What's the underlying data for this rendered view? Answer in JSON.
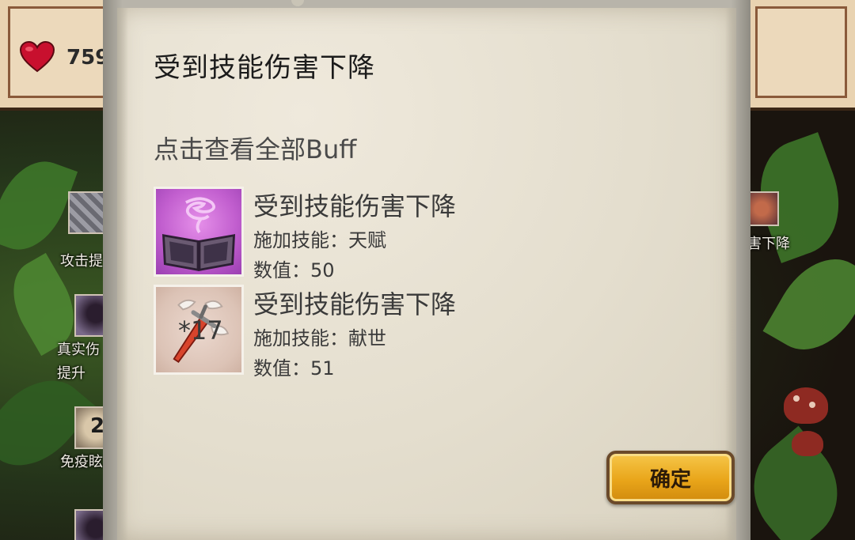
{
  "hud": {
    "hp_value": "759"
  },
  "background_buffs": {
    "left_labels": [
      "攻击提",
      "真实伤",
      "提升",
      "免疫眩"
    ],
    "left_count": "2",
    "right_label": "害下降"
  },
  "dialog": {
    "title": "受到技能伤害下降",
    "view_all_label": "点击查看全部Buff",
    "confirm_label": "确定",
    "buffs": [
      {
        "icon": "talent-book-icon",
        "name": "受到技能伤害下降",
        "skill_line": "施加技能：天赋",
        "value_line": "数值：50"
      },
      {
        "icon": "sword-icon",
        "stack_label": "*17",
        "name": "受到技能伤害下降",
        "skill_line": "施加技能：献世",
        "value_line": "数值：51"
      }
    ]
  },
  "colors": {
    "paper": "#e4dece",
    "button_gold": "#e9a61a",
    "talent_purple": "#c25fcf"
  }
}
